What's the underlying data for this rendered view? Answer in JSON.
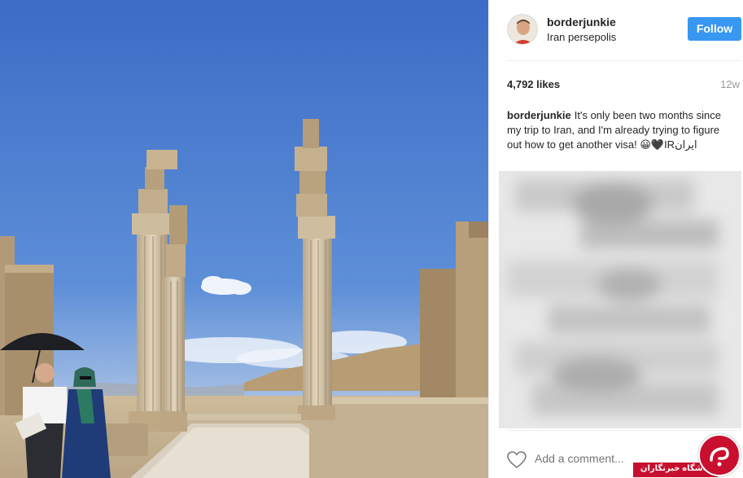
{
  "post": {
    "username": "borderjunkie",
    "location": "Iran persepolis",
    "follow_label": "Follow",
    "likes": "4,792 likes",
    "time_ago": "12w",
    "caption": {
      "user": "borderjunkie",
      "text": "It's only been two months since my trip to Iran, and I'm already trying to figure out how to get another visa! 😀🖤IRایران"
    },
    "comment_placeholder": "Add a comment..."
  },
  "watermark": {
    "text": "باشگاه خبرنگاران"
  },
  "icons": {
    "like": "heart-icon",
    "avatar": "user-avatar",
    "watermark_logo": "logo-icon"
  },
  "colors": {
    "follow_button": "#3897f0",
    "sky": "#3f70c7",
    "watermark": "#c8102e"
  }
}
